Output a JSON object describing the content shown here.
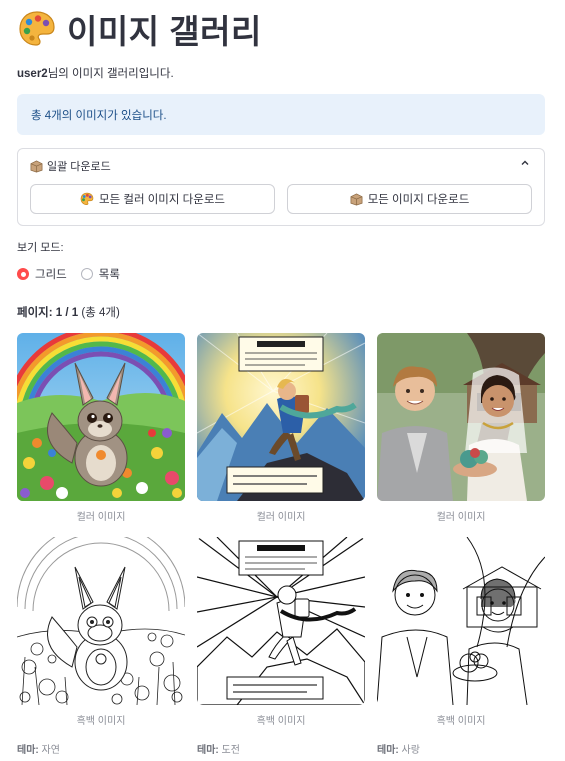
{
  "page": {
    "title": "이미지 갤러리",
    "title_icon": "palette-icon",
    "subtitle_user": "user2",
    "subtitle_rest": "님의 이미지 갤러리입니다."
  },
  "info": {
    "text": "총 4개의 이미지가 있습니다."
  },
  "expander": {
    "label": "일괄 다운로드",
    "icon": "package-icon",
    "expanded": true,
    "buttons": [
      {
        "label": "모든 컬러 이미지 다운로드",
        "icon": "palette-icon"
      },
      {
        "label": "모든 이미지 다운로드",
        "icon": "package-icon"
      }
    ]
  },
  "view_mode": {
    "label": "보기 모드:",
    "options": [
      "그리드",
      "목록"
    ],
    "selected": "그리드"
  },
  "pagination": {
    "label": "페이지:",
    "value": "1 / 1",
    "total": "(총 4개)"
  },
  "gallery": {
    "color_caption": "컬러 이미지",
    "bw_caption": "흑백 이미지",
    "theme_label": "테마:",
    "items": [
      {
        "theme": "자연",
        "subject": "squirrel in flower meadow with rainbow"
      },
      {
        "theme": "도전",
        "subject": "comic hero climbing mountain",
        "comic_title": "COURAGEOUS",
        "comic_top": "A humorous climbing diary on the wind gusts. hey shares everyone humorous and an lmnstrateel.",
        "comic_bottom": "THE CHARACTER SURMOUNTED TRIALS AND TRIBULATIONS."
      },
      {
        "theme": "사랑",
        "subject": "boy and girl with flower bowl"
      }
    ]
  },
  "colors": {
    "accent": "#ff4b4b",
    "info_bg": "#e8f1fb",
    "info_text": "#1c4f88",
    "text": "#31333f",
    "muted": "#8a8d96"
  }
}
